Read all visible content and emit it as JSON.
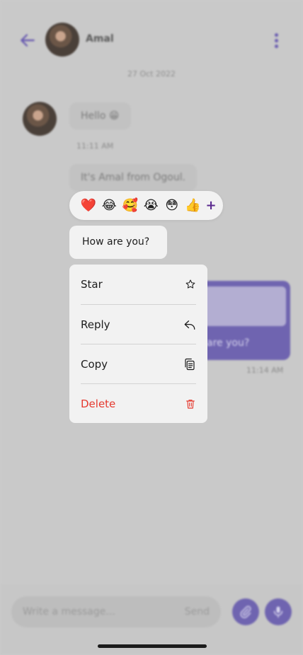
{
  "header": {
    "contact_name": "Amal"
  },
  "chat": {
    "date": "27 Oct 2022",
    "messages": [
      {
        "text": "Hello 😁",
        "time": "11:11 AM"
      },
      {
        "text": "It's Amal from Ogoul."
      }
    ],
    "outgoing": {
      "text": "are you?",
      "time": "11:14 AM"
    }
  },
  "focus": {
    "reactions": [
      "❤️",
      "😂",
      "🥰",
      "😭",
      "😳",
      "👍"
    ],
    "more_reactions": "+",
    "bubble_text": "How are you?",
    "menu": [
      {
        "label": "Star",
        "icon": "star-icon"
      },
      {
        "label": "Reply",
        "icon": "reply-icon"
      },
      {
        "label": "Copy",
        "icon": "copy-icon"
      },
      {
        "label": "Delete",
        "icon": "trash-icon"
      }
    ]
  },
  "composer": {
    "placeholder": "Write a message...",
    "send_label": "Send"
  },
  "colors": {
    "accent": "#6f64b0",
    "danger": "#e5392e",
    "plus": "#5b2a8f"
  }
}
